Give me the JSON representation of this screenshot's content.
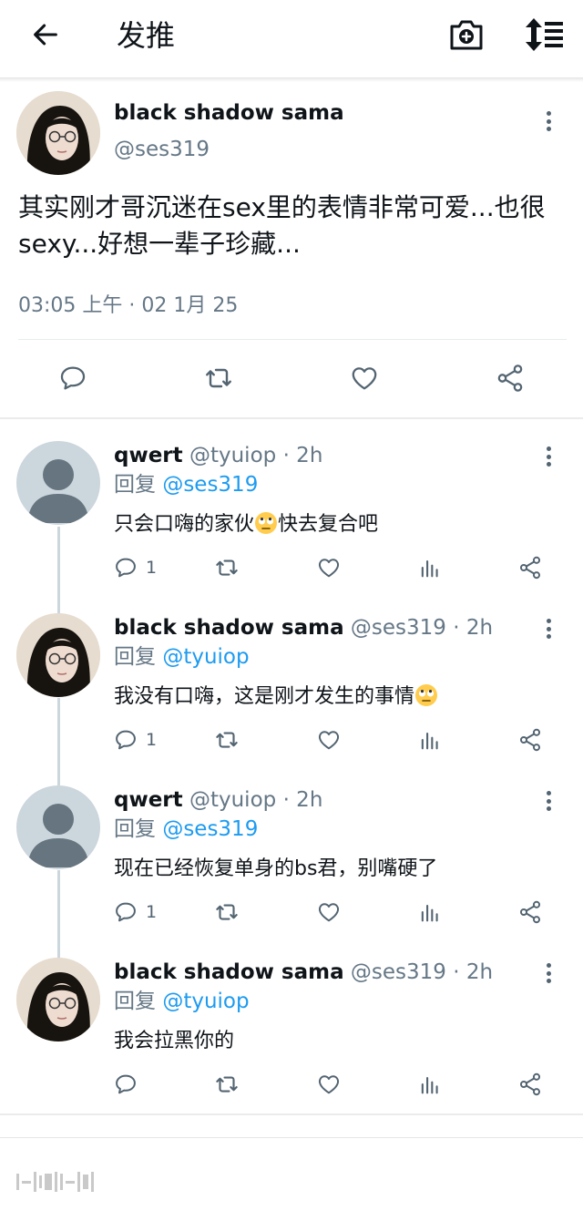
{
  "header": {
    "title": "发推",
    "back_icon": "arrow-left-icon",
    "camera_icon": "camera-add-icon",
    "sort_icon": "sort-icon"
  },
  "main_tweet": {
    "name": "black shadow sama",
    "handle": "@ses319",
    "text": "其实刚才哥沉迷在sex里的表情非常可爱...也很sexy...好想一辈子珍藏...",
    "timestamp": "03:05 上午 · 02 1月 25"
  },
  "replies": [
    {
      "name": "qwert",
      "handle": "@tyuiop",
      "time": "· 2h",
      "reply_prefix": "回复",
      "reply_to": "@ses319",
      "text_before": "只会口嗨的家伙",
      "emoji": "rolling-eyes-emoji",
      "text_after": "快去复合吧",
      "reply_count": "1",
      "avatar": "default"
    },
    {
      "name": "black shadow sama",
      "handle": "@ses319",
      "time": "· 2h",
      "reply_prefix": "回复",
      "reply_to": "@tyuiop",
      "text_before": "我没有口嗨，这是刚才发生的事情",
      "emoji": "rolling-eyes-emoji",
      "text_after": "",
      "reply_count": "1",
      "avatar": "photo"
    },
    {
      "name": "qwert",
      "handle": "@tyuiop",
      "time": "· 2h",
      "reply_prefix": "回复",
      "reply_to": "@ses319",
      "text_before": "现在已经恢复单身的bs君，别嘴硬了",
      "emoji": "",
      "text_after": "",
      "reply_count": "1",
      "avatar": "default"
    },
    {
      "name": "black shadow sama",
      "handle": "@ses319",
      "time": "· 2h",
      "reply_prefix": "回复",
      "reply_to": "@tyuiop",
      "text_before": "我会拉黑你的",
      "emoji": "",
      "text_after": "",
      "reply_count": "",
      "avatar": "photo"
    }
  ],
  "colors": {
    "mention": "#1d9bf0",
    "secondary": "#657786",
    "thread_line": "#ccd6dd",
    "icon": "#536471"
  }
}
